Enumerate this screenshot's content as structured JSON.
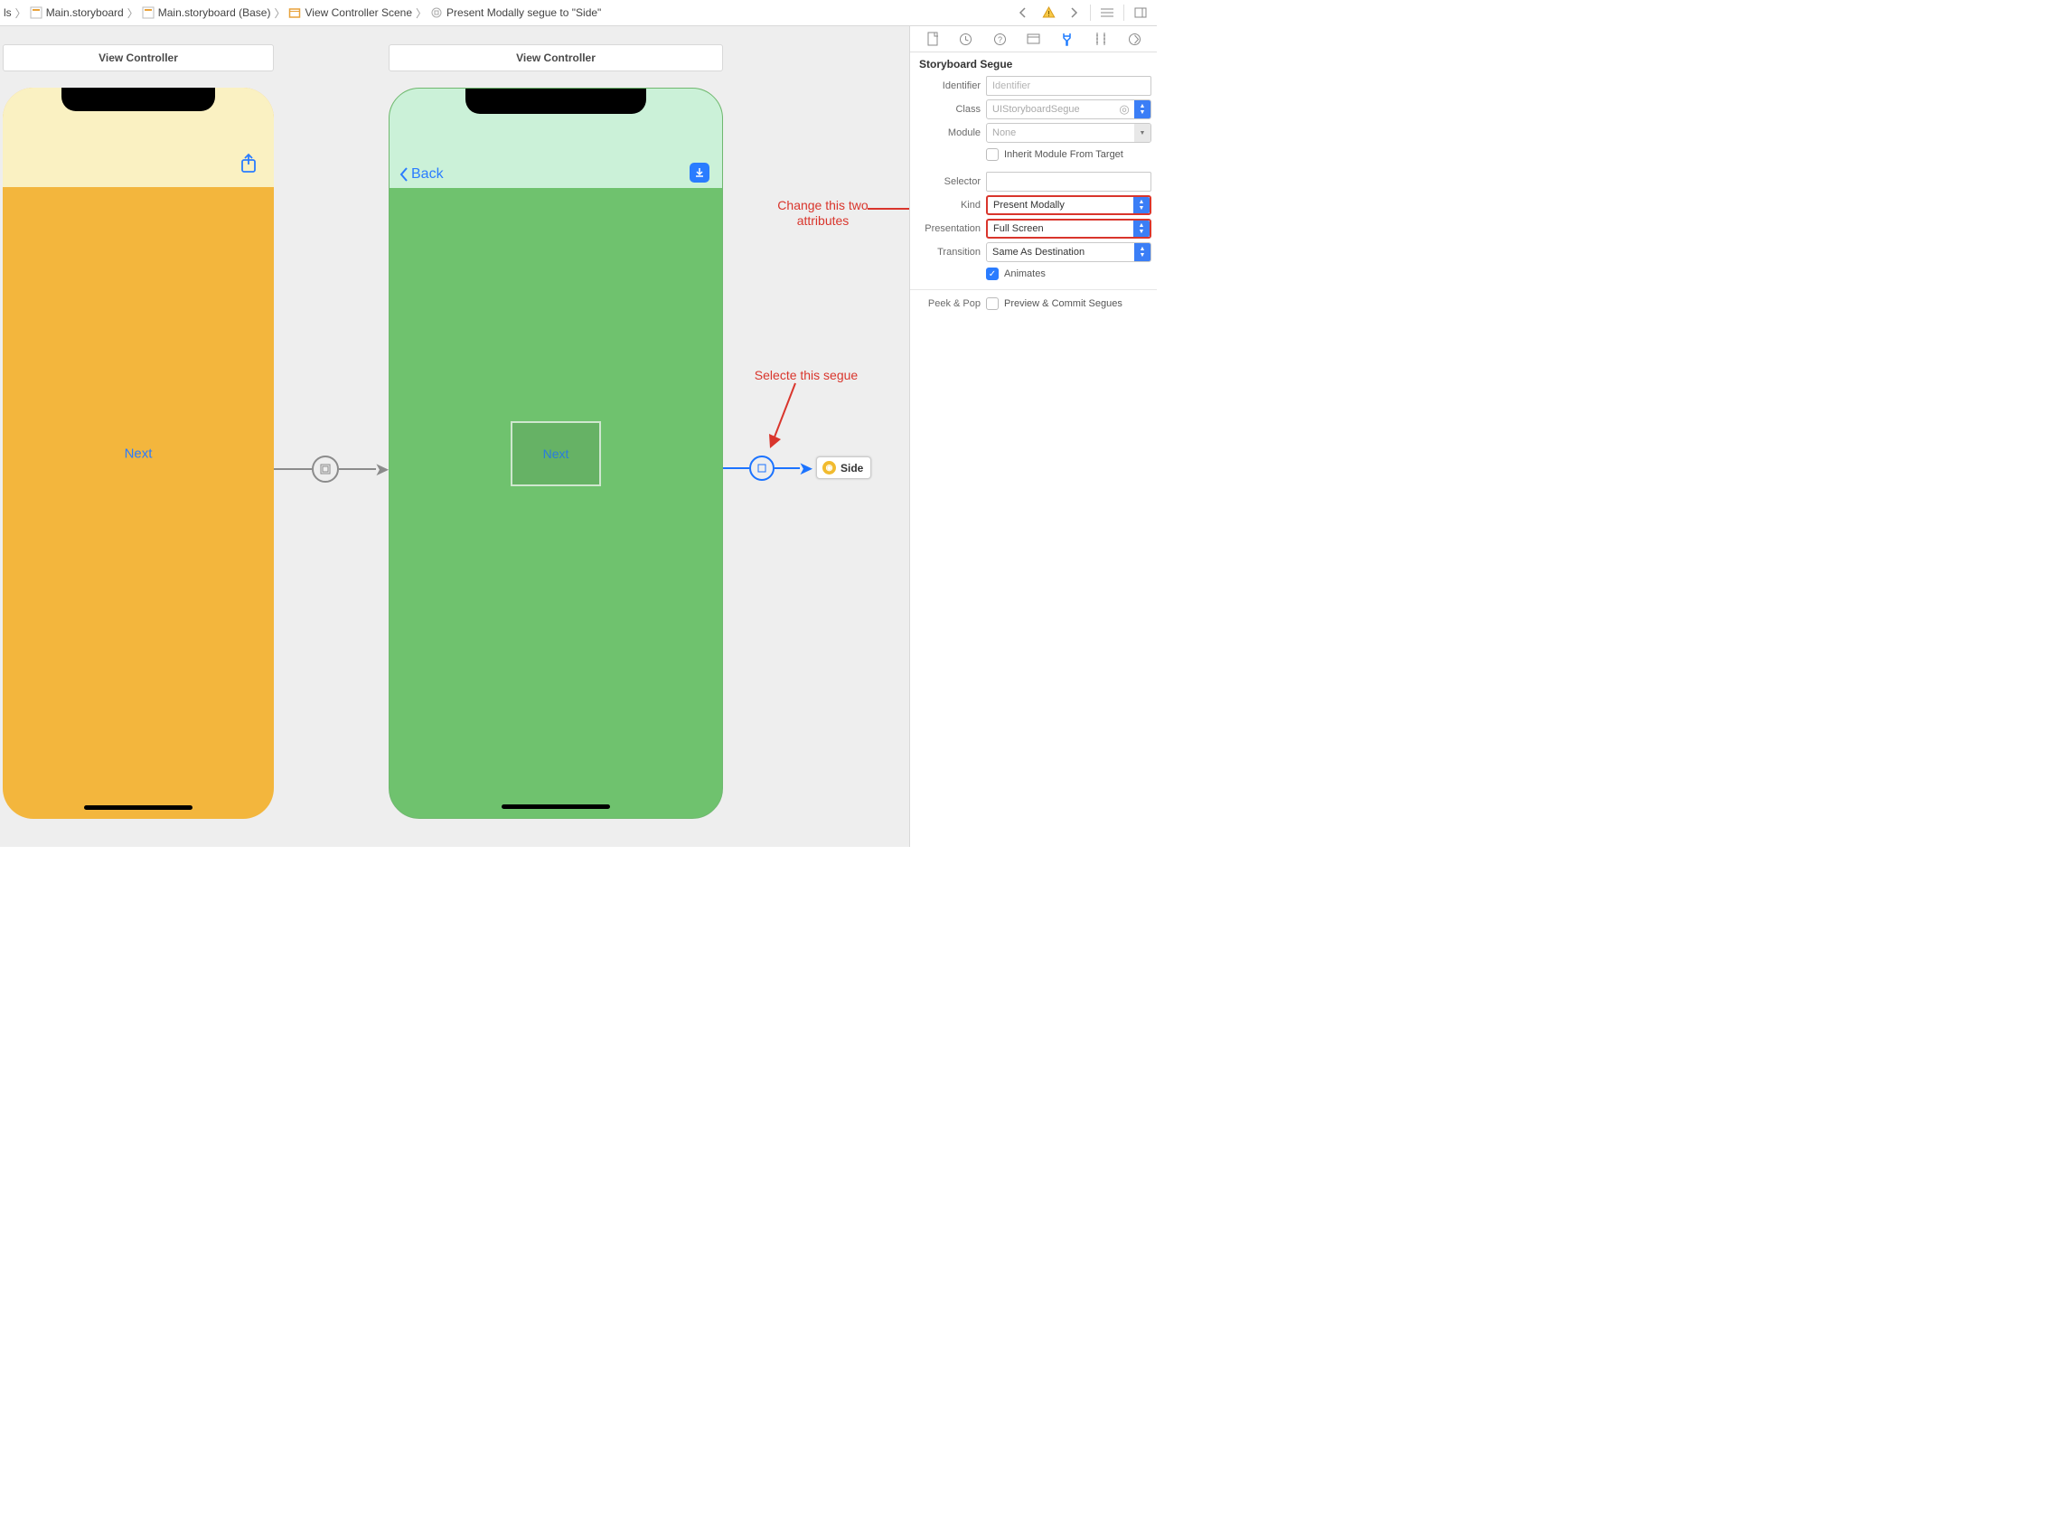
{
  "breadcrumbs": [
    {
      "label": "ls"
    },
    {
      "label": "Main.storyboard"
    },
    {
      "label": "Main.storyboard (Base)"
    },
    {
      "label": "View Controller Scene"
    },
    {
      "label": "Present Modally segue to \"Side\""
    }
  ],
  "scenes": {
    "left": {
      "title": "View Controller",
      "next_label": "Next"
    },
    "mid": {
      "title": "View Controller",
      "back_label": "Back",
      "next_label": "Next"
    },
    "side_chip": "Side"
  },
  "annotations": {
    "change_attrs": "Change this two\nattributes",
    "select_segue": "Selecte this segue"
  },
  "inspector": {
    "section_title": "Storyboard Segue",
    "identifier": {
      "label": "Identifier",
      "placeholder": "Identifier",
      "value": ""
    },
    "klass": {
      "label": "Class",
      "placeholder": "UIStoryboardSegue",
      "value": ""
    },
    "module": {
      "label": "Module",
      "placeholder": "None",
      "value": ""
    },
    "inherit": {
      "label": "Inherit Module From Target",
      "checked": false
    },
    "selector": {
      "label": "Selector",
      "value": ""
    },
    "kind": {
      "label": "Kind",
      "value": "Present Modally"
    },
    "presentation": {
      "label": "Presentation",
      "value": "Full Screen"
    },
    "transition": {
      "label": "Transition",
      "value": "Same As Destination"
    },
    "animates": {
      "label": "Animates",
      "checked": true
    },
    "peek_pop_label": "Peek & Pop",
    "peek_pop": {
      "label": "Preview & Commit Segues",
      "checked": false
    }
  }
}
